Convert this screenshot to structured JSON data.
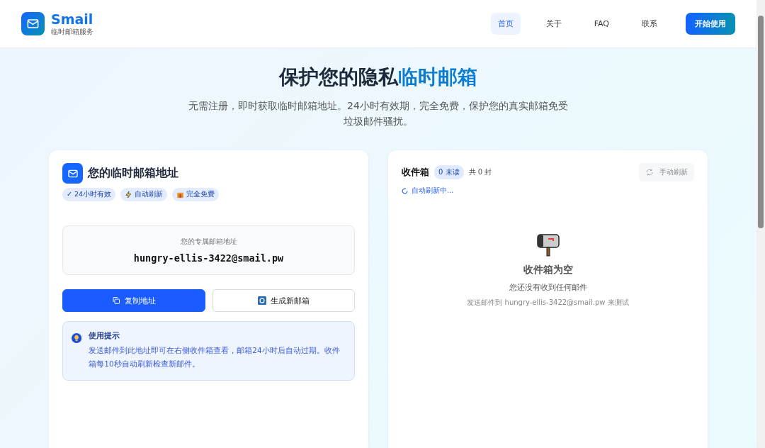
{
  "brand": {
    "name": "Smail",
    "tagline": "临时邮箱服务"
  },
  "nav": [
    {
      "label": "首页",
      "selected": true
    },
    {
      "label": "关于",
      "selected": false
    },
    {
      "label": "FAQ",
      "selected": false
    },
    {
      "label": "联系",
      "selected": false
    }
  ],
  "cta": "开始使用",
  "hero": {
    "title_plain": "保护您的隐私",
    "title_accent": "临时邮箱",
    "subtitle": "无需注册，即时获取临时邮箱地址。24小时有效期，完全免费，保护您的真实邮箱免受垃圾邮件骚扰。"
  },
  "address_card": {
    "title": "您的临时邮箱地址",
    "badges": [
      {
        "kind": "text",
        "label": "✓ 24小时有效"
      },
      {
        "kind": "bolt",
        "label": "自动刷新"
      },
      {
        "kind": "gift",
        "label": "完全免费"
      }
    ],
    "address_label": "您的专属邮箱地址",
    "address": "hungry-ellis-3422@smail.pw",
    "copy_button": "复制地址",
    "new_button": "生成新邮箱",
    "tip_title": "使用提示",
    "tip_text": "发送邮件到此地址即可在右侧收件箱查看，邮箱24小时后自动过期。收件箱每10秒自动刷新检查新邮件。"
  },
  "inbox": {
    "title": "收件箱",
    "unread": "0 未读",
    "total": "共 0 封",
    "status": "自动刷新中...",
    "refresh_button": "手动刷新",
    "empty_title": "收件箱为空",
    "empty_text": "您还没有收到任何邮件",
    "empty_hint": "发送邮件到 hungry-ellis-3422@smail.pw 来测试"
  }
}
